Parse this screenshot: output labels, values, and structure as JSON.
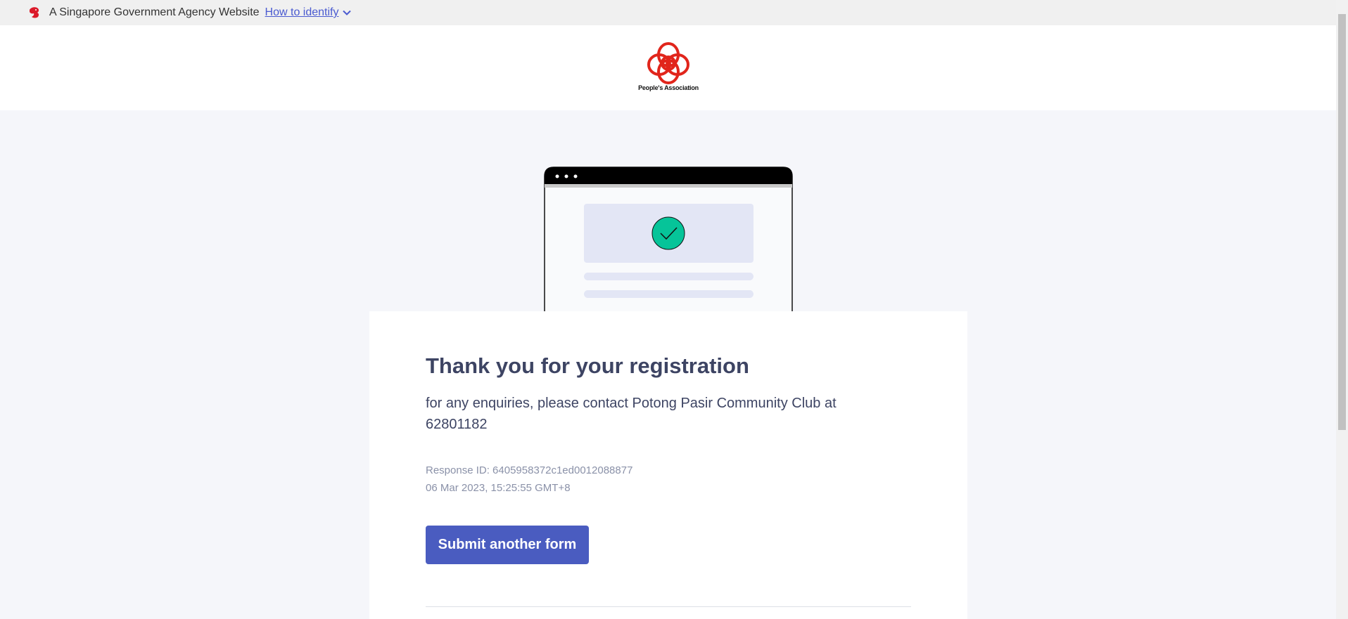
{
  "masthead": {
    "text": "A Singapore Government Agency Website",
    "link_label": "How to identify",
    "lion_icon": "singapore-lion-icon",
    "chevron_icon": "chevron-down-icon"
  },
  "header": {
    "logo_caption": "People's Association",
    "logo_color": "#e1251b"
  },
  "illustration": {
    "check_icon": "check-circle-icon",
    "check_color": "#06c499"
  },
  "confirmation": {
    "title": "Thank you for your registration",
    "message": "for any enquiries,  please contact Potong Pasir Community Club at 62801182",
    "response_id": "Response ID: 6405958372c1ed0012088877",
    "timestamp": "06 Mar 2023, 15:25:55 GMT+8",
    "submit_label": "Submit another form"
  },
  "colors": {
    "accent": "#4a5cc0",
    "text": "#3d4463",
    "muted": "#8a91a8",
    "background": "#f5f6fa"
  }
}
